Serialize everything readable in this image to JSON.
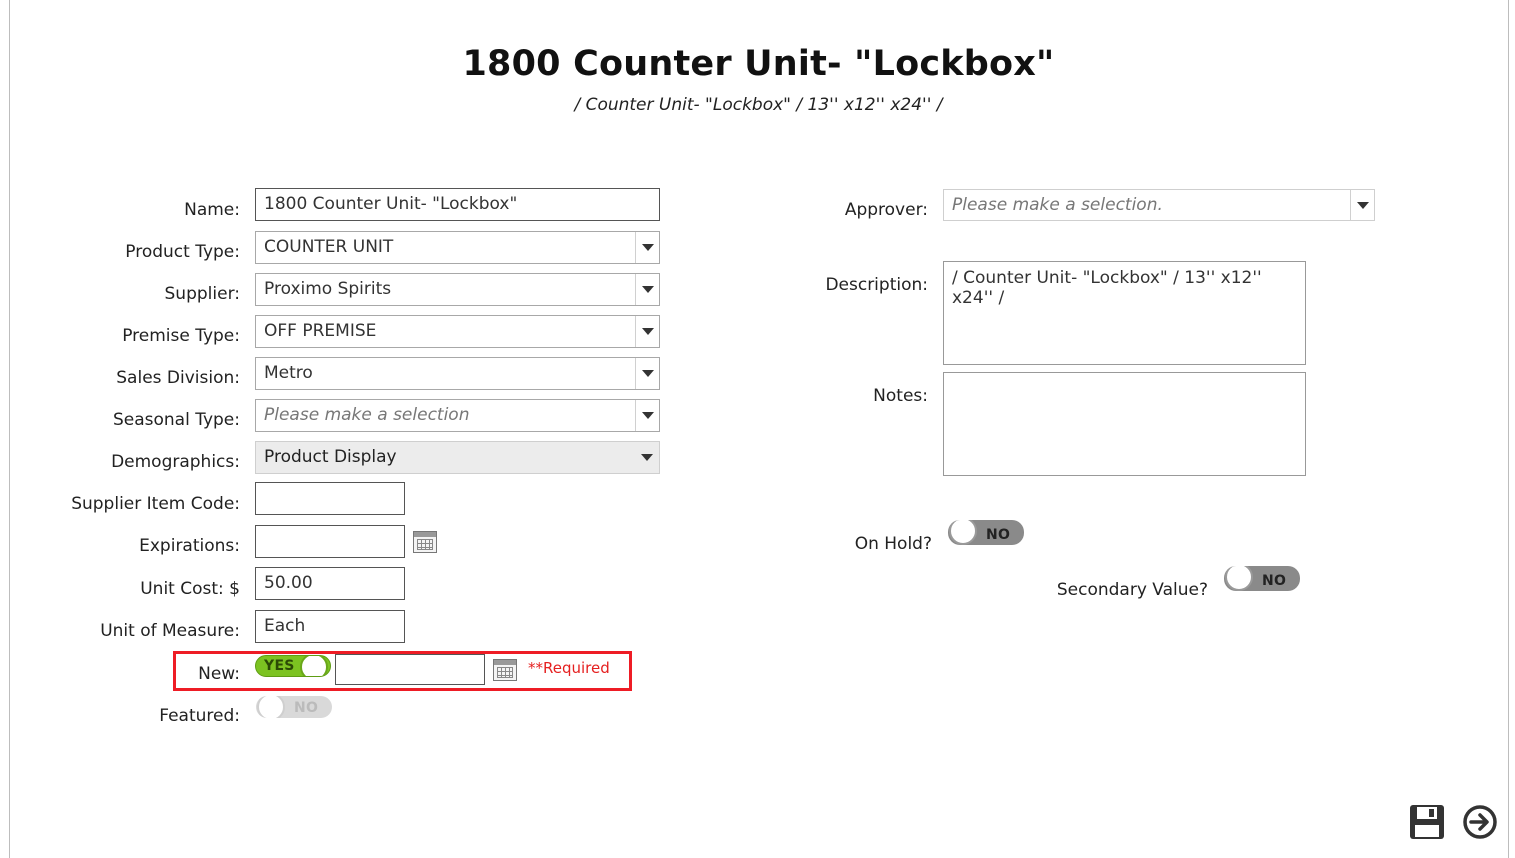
{
  "header": {
    "title": "1800 Counter Unit- \"Lockbox\"",
    "subtitle": "/ Counter Unit- \"Lockbox\" / 13'' x12'' x24'' /"
  },
  "left_form": {
    "name": {
      "label": "Name:",
      "value": "1800 Counter Unit- \"Lockbox\""
    },
    "product_type": {
      "label": "Product Type:",
      "value": "COUNTER UNIT"
    },
    "supplier": {
      "label": "Supplier:",
      "value": "Proximo Spirits"
    },
    "premise_type": {
      "label": "Premise Type:",
      "value": "OFF PREMISE"
    },
    "sales_division": {
      "label": "Sales Division:",
      "value": "Metro"
    },
    "seasonal_type": {
      "label": "Seasonal Type:",
      "placeholder": "Please make a selection"
    },
    "demographics": {
      "label": "Demographics:",
      "value": "Product Display"
    },
    "supplier_item_code": {
      "label": "Supplier Item Code:",
      "value": ""
    },
    "expirations": {
      "label": "Expirations:",
      "value": "",
      "icon": "calendar-icon"
    },
    "unit_cost": {
      "label": "Unit Cost: $",
      "value": "50.00"
    },
    "unit_of_measure": {
      "label": "Unit of Measure:",
      "value": "Each"
    },
    "new": {
      "label": "New:",
      "toggle": "YES",
      "date_value": "",
      "required_text": "**Required",
      "icon": "calendar-icon"
    },
    "featured": {
      "label": "Featured:",
      "toggle": "NO"
    }
  },
  "right_form": {
    "approver": {
      "label": "Approver:",
      "placeholder": "Please make a selection."
    },
    "description": {
      "label": "Description:",
      "value": "/ Counter Unit- \"Lockbox\" / 13'' x12'' x24'' /"
    },
    "notes": {
      "label": "Notes:",
      "value": ""
    },
    "on_hold": {
      "label": "On Hold?",
      "toggle": "NO"
    },
    "secondary_value": {
      "label": "Secondary Value?",
      "toggle": "NO"
    }
  },
  "actions": {
    "save_icon": "save-icon",
    "next_icon": "arrow-right-circle-icon"
  },
  "colors": {
    "toggle_on": "#7cc321",
    "toggle_off": "#8a8a8a",
    "highlight": "#ee1c25",
    "required": "#e52020"
  }
}
